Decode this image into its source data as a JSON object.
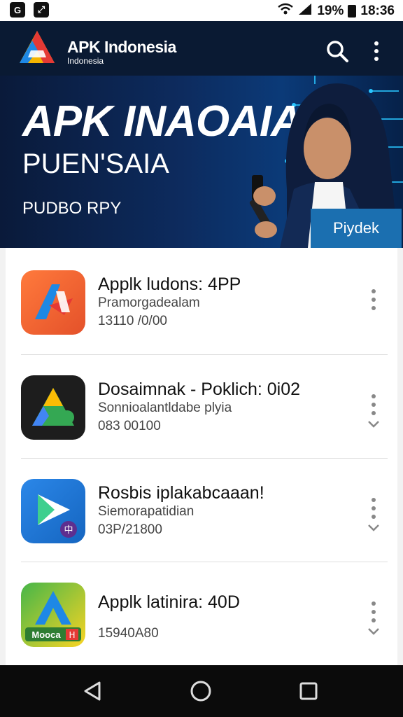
{
  "status_bar": {
    "left_icons": [
      "app-icon",
      "expand-icon"
    ],
    "right_icons": [
      "wifi-icon",
      "signal-icon"
    ],
    "battery_percent": "19%",
    "time": "18:36"
  },
  "banner": {
    "brand": "APK Indonesia",
    "brand_sub": "Indonesia",
    "headline": "APK INAOAIA",
    "subhead": "PUEN'SAIA",
    "tagline": "PUDBO RPY",
    "cta_label": "Piydek"
  },
  "apps": [
    {
      "title": "Applk ludons: 4PP",
      "desc": "Pramorgadealam",
      "meta": "13110 /0/00",
      "icon": "orange-arrow-icon"
    },
    {
      "title": "Dosaimnak - Poklich: 0i02",
      "desc": "Sonnioalantldabe plyia",
      "meta": "083 00100",
      "icon": "dark-triangle-icon"
    },
    {
      "title": "Rosbis iplakabcaaan!",
      "desc": "Siemorapatidian",
      "meta": "03P/21800",
      "icon": "blue-play-icon"
    },
    {
      "title": "Applk latinira: 40D",
      "desc": "",
      "meta": "15940A80",
      "icon": "green-a-icon",
      "badge": "Mooca"
    }
  ],
  "icon_badges": {
    "item3": "中",
    "item4": "H"
  },
  "colors": {
    "banner_dark": "#0a1a33",
    "cta": "#1b6fb0",
    "nav": "#0b0b0b"
  }
}
